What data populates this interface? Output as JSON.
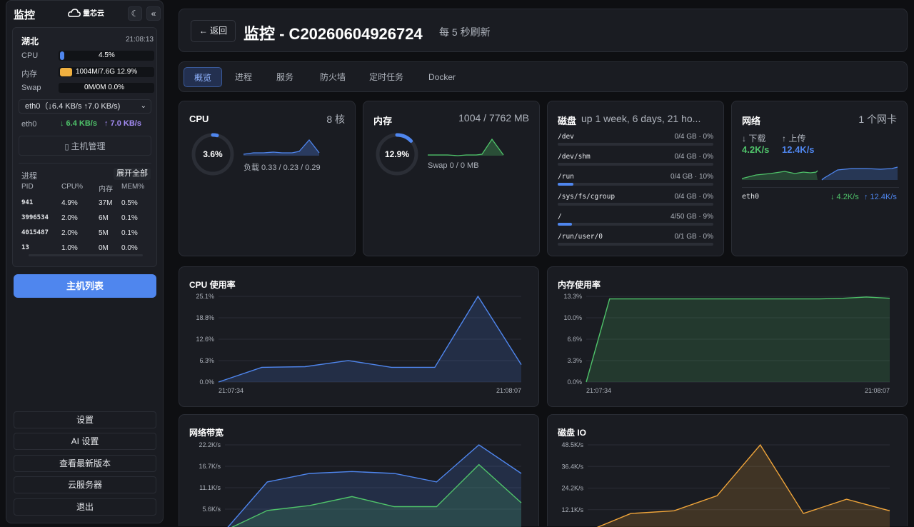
{
  "sidebar": {
    "title": "监控",
    "logo_text": "量芯云",
    "theme_btn": "☾",
    "collapse_btn": "«",
    "host": {
      "region": "湖北",
      "time": "21:08:13",
      "cpu_label": "CPU",
      "cpu_value": "4.5%",
      "cpu_fraction": 0.045,
      "mem_label": "内存",
      "mem_value": "1004M/7.6G 12.9%",
      "mem_fraction": 0.129,
      "swap_label": "Swap",
      "swap_value": "0M/0M 0.0%",
      "swap_fraction": 0.0,
      "net_select": "eth0（↓6.4 KB/s ↑7.0 KB/s)",
      "net_iface": "eth0",
      "net_down": "↓ 6.4 KB/s",
      "net_up": "↑ 7.0 KB/s",
      "manage_btn": "主机管理",
      "proc_title": "进程",
      "expand_btn": "展开全部",
      "proc_headers": [
        "PID",
        "CPU%",
        "内存",
        "MEM%"
      ],
      "processes": [
        {
          "pid": "941",
          "cpu": "4.9%",
          "mem": "37M",
          "memp": "0.5%"
        },
        {
          "pid": "3996534",
          "cpu": "2.0%",
          "mem": "6M",
          "memp": "0.1%"
        },
        {
          "pid": "4015487",
          "cpu": "2.0%",
          "mem": "5M",
          "memp": "0.1%"
        },
        {
          "pid": "13",
          "cpu": "1.0%",
          "mem": "0M",
          "memp": "0.0%"
        }
      ]
    },
    "host_list_btn": "主机列表",
    "bottom_buttons": [
      "设置",
      "AI 设置",
      "查看最新版本",
      "云服务器",
      "退出"
    ]
  },
  "header": {
    "back_label": "← 返回",
    "title": "监控 - C20260604926724",
    "refresh_text": "每 5 秒刷新"
  },
  "tabs": [
    "概览",
    "进程",
    "服务",
    "防火墙",
    "定时任务",
    "Docker"
  ],
  "cpu_panel": {
    "title": "CPU",
    "cores": "8 核",
    "usage": "3.6%",
    "usage_fraction": 0.036,
    "load": "负载 0.33 / 0.23 / 0.29"
  },
  "mem_panel": {
    "title": "内存",
    "detail": "1004 / 7762 MB",
    "usage": "12.9%",
    "usage_fraction": 0.129,
    "swap": "Swap 0 / 0 MB"
  },
  "disk_panel": {
    "title": "磁盘",
    "uptime": "up 1 week, 6 days, 21 ho...",
    "disks": [
      {
        "name": "/dev",
        "value": "0/4 GB · 0%",
        "fraction": 0.0
      },
      {
        "name": "/dev/shm",
        "value": "0/4 GB · 0%",
        "fraction": 0.0
      },
      {
        "name": "/run",
        "value": "0/4 GB · 10%",
        "fraction": 0.1
      },
      {
        "name": "/sys/fs/cgroup",
        "value": "0/4 GB · 0%",
        "fraction": 0.0
      },
      {
        "name": "/",
        "value": "4/50 GB · 9%",
        "fraction": 0.09
      },
      {
        "name": "/run/user/0",
        "value": "0/1 GB · 0%",
        "fraction": 0.0
      }
    ]
  },
  "net_panel": {
    "title": "网络",
    "nic_count": "1 个网卡",
    "down_label": "↓ 下载",
    "up_label": "↑ 上传",
    "down_value": "4.2K/s",
    "up_value": "12.4K/s",
    "iface": "eth0",
    "iface_down": "↓ 4.2K/s",
    "iface_up": "↑ 12.4K/s"
  },
  "colors": {
    "accent": "#4f86ee",
    "green": "#4fc36a",
    "orange": "#f0a53a",
    "purple": "#a48cf5",
    "bg": "#0e0f12",
    "panel": "#1a1c22"
  },
  "chart_data": [
    {
      "type": "area",
      "title": "CPU 使用率",
      "x_tick_labels": [
        "21:07:34",
        "21:08:07"
      ],
      "y_tick_labels": [
        "25.1%",
        "18.8%",
        "12.6%",
        "6.3%",
        "0.0%"
      ],
      "ylim": [
        0,
        25.1
      ],
      "series": [
        {
          "values": [
            0.0,
            4.3,
            4.5,
            6.3,
            4.3,
            4.3,
            25.1,
            5.1
          ],
          "color": "#4f86ee"
        }
      ]
    },
    {
      "type": "area",
      "title": "内存使用率",
      "x_tick_labels": [
        "21:07:34",
        "21:08:07"
      ],
      "y_tick_labels": [
        "13.3%",
        "10.0%",
        "6.6%",
        "3.3%",
        "0.0%"
      ],
      "ylim": [
        0,
        13.3
      ],
      "series": [
        {
          "values": [
            0.0,
            12.9,
            12.9,
            12.9,
            12.9,
            12.9,
            12.9,
            12.9,
            12.9,
            12.9,
            12.9,
            13.0,
            13.2,
            13.0
          ],
          "color": "#4fc36a"
        }
      ]
    },
    {
      "type": "area",
      "title": "网络带宽",
      "y_tick_labels": [
        "22.2K/s",
        "16.7K/s",
        "11.1K/s",
        "5.6K/s"
      ],
      "ylim": [
        0,
        22.2
      ],
      "series": [
        {
          "values": [
            0.0,
            12.6,
            14.8,
            15.3,
            14.8,
            12.6,
            22.2,
            14.8
          ],
          "color": "#4f86ee"
        },
        {
          "values": [
            0.0,
            5.2,
            6.5,
            8.8,
            6.2,
            6.2,
            17.1,
            7.2
          ],
          "color": "#4fc36a"
        }
      ]
    },
    {
      "type": "area",
      "title": "磁盘 IO",
      "y_tick_labels": [
        "48.5K/s",
        "36.4K/s",
        "24.2K/s",
        "12.1K/s"
      ],
      "ylim": [
        0,
        48.5
      ],
      "series": [
        {
          "values": [
            0.0,
            10.0,
            11.5,
            20.0,
            48.5,
            10.0,
            18.0,
            11.5
          ],
          "color": "#f0a53a"
        }
      ]
    }
  ]
}
